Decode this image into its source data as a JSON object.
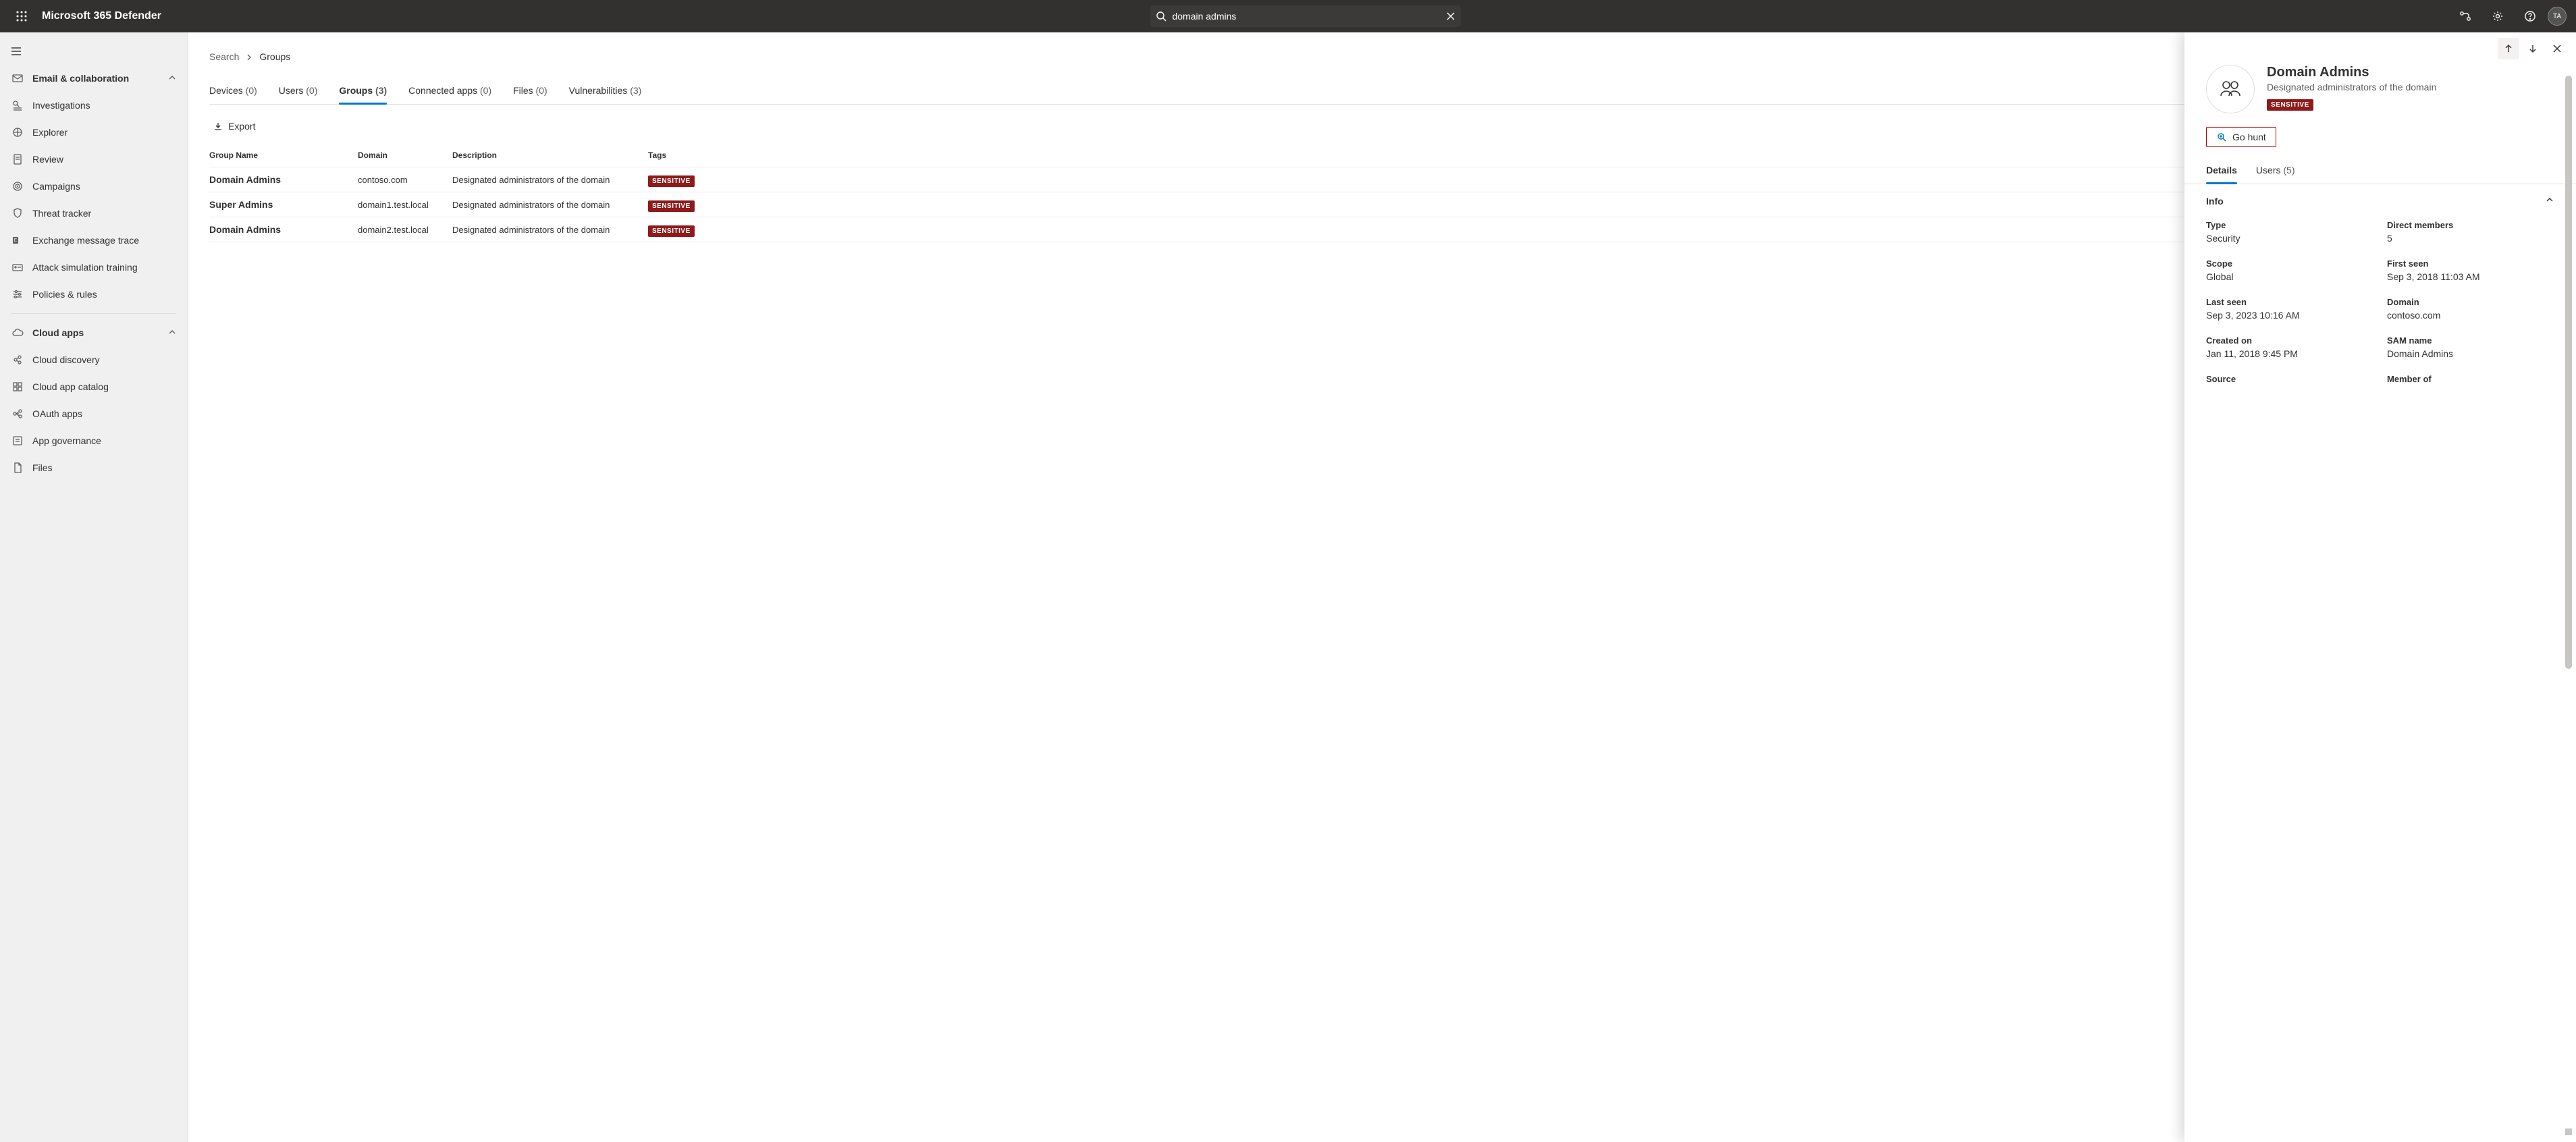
{
  "header": {
    "app_title": "Microsoft 365 Defender",
    "search_value": "domain admins",
    "avatar_initials": "TA"
  },
  "sidebar": {
    "section1_label": "Email & collaboration",
    "items1": [
      {
        "icon": "search-list",
        "label": "Investigations"
      },
      {
        "icon": "explorer",
        "label": "Explorer"
      },
      {
        "icon": "doc",
        "label": "Review"
      },
      {
        "icon": "target",
        "label": "Campaigns"
      },
      {
        "icon": "shield",
        "label": "Threat tracker"
      },
      {
        "icon": "exchange",
        "label": "Exchange message trace"
      },
      {
        "icon": "sim",
        "label": "Attack simulation training"
      },
      {
        "icon": "sliders",
        "label": "Policies & rules"
      }
    ],
    "section2_label": "Cloud apps",
    "items2": [
      {
        "icon": "discovery",
        "label": "Cloud discovery"
      },
      {
        "icon": "catalog",
        "label": "Cloud app catalog"
      },
      {
        "icon": "oauth",
        "label": "OAuth apps"
      },
      {
        "icon": "governance",
        "label": "App governance"
      },
      {
        "icon": "files",
        "label": "Files"
      }
    ]
  },
  "breadcrumbs": {
    "root": "Search",
    "current": "Groups"
  },
  "tabs": [
    {
      "label": "Devices",
      "count": "(0)"
    },
    {
      "label": "Users",
      "count": "(0)"
    },
    {
      "label": "Groups",
      "count": "(3)",
      "active": true
    },
    {
      "label": "Connected apps",
      "count": "(0)"
    },
    {
      "label": "Files",
      "count": "(0)"
    },
    {
      "label": "Vulnerabilities",
      "count": "(3)"
    }
  ],
  "toolbar": {
    "export": "Export"
  },
  "table": {
    "headers": {
      "name": "Group Name",
      "domain": "Domain",
      "desc": "Description",
      "tags": "Tags"
    },
    "rows": [
      {
        "name": "Domain Admins",
        "domain": "contoso.com",
        "desc": "Designated administrators of the domain",
        "tag": "SENSITIVE"
      },
      {
        "name": "Super Admins",
        "domain": "domain1.test.local",
        "desc": "Designated administrators of the domain",
        "tag": "SENSITIVE"
      },
      {
        "name": "Domain Admins",
        "domain": "domain2.test.local",
        "desc": "Designated administrators of the domain",
        "tag": "SENSITIVE"
      }
    ]
  },
  "panel": {
    "title": "Domain Admins",
    "subtitle": "Designated administrators of the domain",
    "badge": "SENSITIVE",
    "go_hunt": "Go hunt",
    "tabs": [
      {
        "label": "Details",
        "active": true
      },
      {
        "label": "Users",
        "count": "(5)"
      }
    ],
    "section_info": "Info",
    "fields": {
      "type_label": "Type",
      "type_value": "Security",
      "direct_label": "Direct members",
      "direct_value": "5",
      "scope_label": "Scope",
      "scope_value": "Global",
      "first_label": "First seen",
      "first_value": "Sep 3, 2018 11:03 AM",
      "last_label": "Last seen",
      "last_value": "Sep 3, 2023 10:16 AM",
      "domain_label": "Domain",
      "domain_value": "contoso.com",
      "created_label": "Created on",
      "created_value": "Jan 11, 2018 9:45 PM",
      "sam_label": "SAM name",
      "sam_value": "Domain Admins",
      "source_label": "Source",
      "member_label": "Member of"
    }
  }
}
